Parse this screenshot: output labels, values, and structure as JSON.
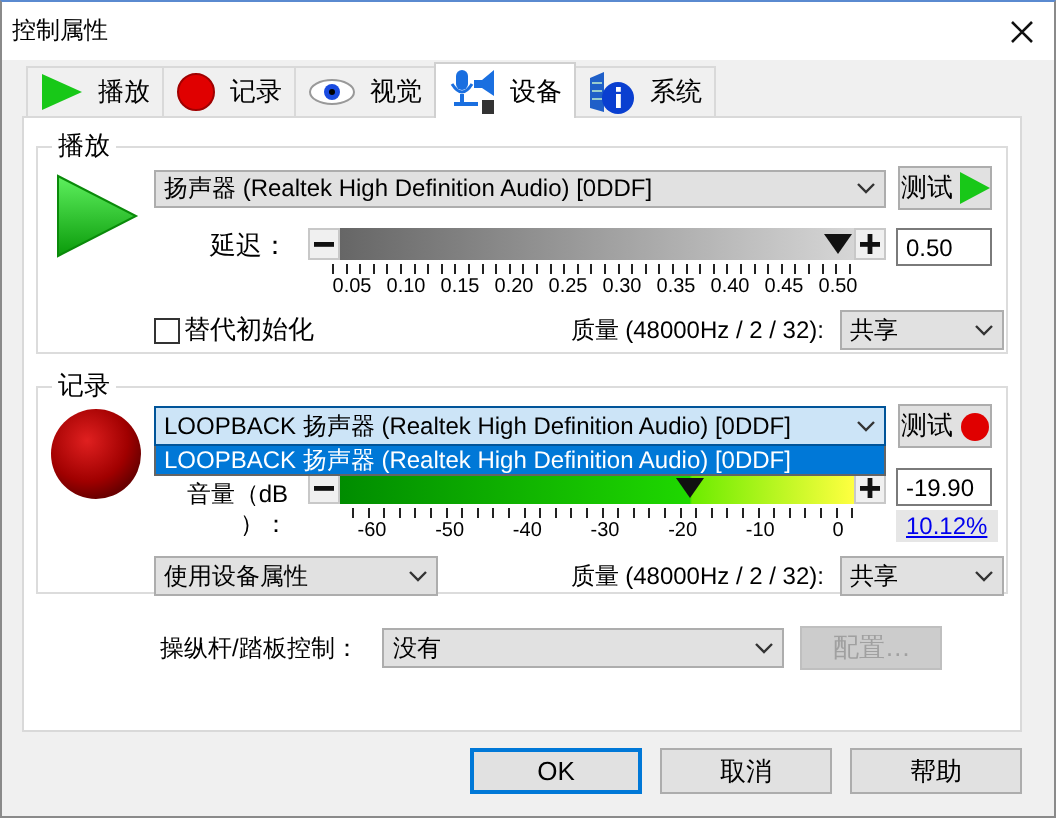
{
  "window": {
    "title": "控制属性"
  },
  "tabs": [
    {
      "label": "播放",
      "selected": false
    },
    {
      "label": "记录",
      "selected": false
    },
    {
      "label": "视觉",
      "selected": false
    },
    {
      "label": "设备",
      "selected": true
    },
    {
      "label": "系统",
      "selected": false
    }
  ],
  "playback": {
    "title": "播放",
    "device": {
      "value": "扬声器 (Realtek High Definition Audio) [0DDF]",
      "focused": false
    },
    "test_button": "测试",
    "latency": {
      "label": "延迟：",
      "level": 0.97,
      "value": "0.50",
      "ticks": [
        "0.05",
        "0.10",
        "0.15",
        "0.20",
        "0.25",
        "0.30",
        "0.35",
        "0.40",
        "0.45",
        "0.50"
      ]
    },
    "alt_init": {
      "label": "替代初始化",
      "checked": false
    },
    "quality": {
      "label": "质量 (48000Hz / 2 / 32):",
      "value": "共享"
    }
  },
  "record": {
    "title": "记录",
    "device": {
      "value": "LOOPBACK 扬声器 (Realtek High Definition Audio) [0DDF]",
      "focused": true,
      "options": [
        {
          "label": "LOOPBACK 扬声器 (Realtek High Definition Audio) [0DDF]",
          "selected": true
        }
      ]
    },
    "test_button": "测试",
    "volume": {
      "label": "音量（dB ）：",
      "level": 0.68,
      "value": "-19.90",
      "percent": "10.12%",
      "ticks": [
        "-60",
        "-50",
        "-40",
        "-30",
        "-20",
        "-10",
        "0"
      ]
    },
    "mode": {
      "value": "使用设备属性"
    },
    "quality": {
      "label": "质量 (48000Hz / 2 / 32):",
      "value": "共享"
    }
  },
  "joystick": {
    "label": "操纵杆/踏板控制：",
    "value": "没有",
    "config": {
      "label": "配置…",
      "disabled": true
    }
  },
  "buttons": [
    {
      "label": "OK",
      "default": true
    },
    {
      "label": "取消",
      "default": false
    },
    {
      "label": "帮助",
      "default": false
    }
  ]
}
